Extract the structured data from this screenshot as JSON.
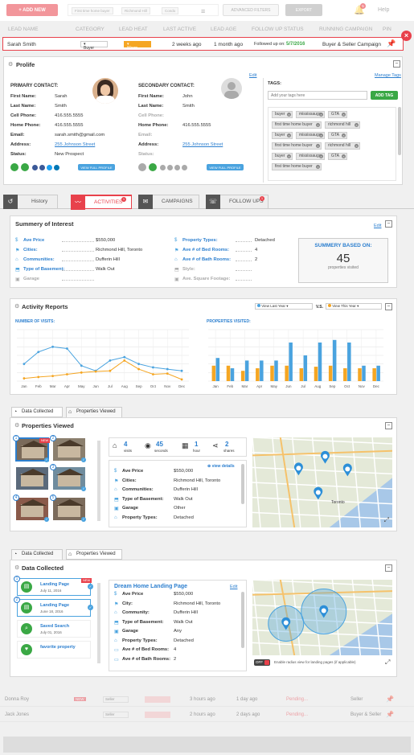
{
  "topbar": {
    "add_new": "+ ADD NEW",
    "filter_chips": [
      "First time home buyer",
      "Richmond Hill",
      "Condo"
    ],
    "advanced_filters": "ADVANCED FILTERS",
    "export": "EXPORT",
    "help": "Help",
    "notif_count": "5"
  },
  "columns": [
    "LEAD NAME",
    "CATEGORY",
    "LEAD HEAT",
    "LAST ACTIVE",
    "LEAD AGE",
    "FOLLOW UP STATUS",
    "RUNNING CAMPAIGN",
    "PIN"
  ],
  "lead": {
    "name": "Sarah Smith",
    "category": "Buyer",
    "heat": "Warm",
    "last_active": "2 weeks ago",
    "age": "1 month ago",
    "followup_label": "Followed up on:",
    "followup_date": "5/7/2016",
    "campaign": "Buyer & Seller Campaign"
  },
  "profile": {
    "title": "Prolife",
    "edit": "Edit",
    "manage_tags": "Manage Tags",
    "primary_header": "PRIMARY CONTACT:",
    "secondary_header": "SECONDARY CONTACT:",
    "primary": [
      {
        "label": "First Name:",
        "value": "Sarah"
      },
      {
        "label": "Last Name:",
        "value": "Smith"
      },
      {
        "label": "Cell Phone:",
        "value": "416.555.5555"
      },
      {
        "label": "Home Phone:",
        "value": "416.555.5555"
      },
      {
        "label": "Email:",
        "value": "sarah.smith@gmail.com"
      },
      {
        "label": "Address:",
        "value": "255 Johnson Street"
      },
      {
        "label": "Status:",
        "value": "New Prospect"
      }
    ],
    "secondary": [
      {
        "label": "First Name:",
        "value": "John"
      },
      {
        "label": "Last Name:",
        "value": "Smith"
      },
      {
        "label": "Cell Phone:",
        "value": ""
      },
      {
        "label": "Home Phone:",
        "value": "416.555.5555"
      },
      {
        "label": "Email:",
        "value": ""
      },
      {
        "label": "Address:",
        "value": "255 Johnson Street"
      },
      {
        "label": "Status:",
        "value": ""
      }
    ],
    "view_full_profile": "VIEW FULL PROFILE",
    "tags_label": "TAGS:",
    "tag_placeholder": "Add your tags here",
    "add_tag": "ADD TAG",
    "tags": [
      [
        "buyer",
        "mississauga",
        "GTA"
      ],
      [
        "first time home buyer",
        "richmond hill"
      ],
      [
        "buyer",
        "mississauga",
        "GTA"
      ],
      [
        "first time home buyer",
        "richmond hill"
      ],
      [
        "buyer",
        "mississauga",
        "GTA"
      ],
      [
        "first time home buyer"
      ]
    ]
  },
  "tabs": [
    {
      "label": "History",
      "icon": "history-icon"
    },
    {
      "label": "ACTIVITIES",
      "icon": "pulse-icon",
      "badge": "1"
    },
    {
      "label": "CAMPAIGNS",
      "icon": "mail-icon"
    },
    {
      "label": "FOLLOW UPS",
      "icon": "followup-icon",
      "badge": "1"
    }
  ],
  "summary": {
    "title": "Summery of Interest",
    "edit": "Edit",
    "left": [
      {
        "label": "Ave Price",
        "value": "$550,000"
      },
      {
        "label": "Cities:",
        "value": "Richmond Hill, Toronto"
      },
      {
        "label": "Communities:",
        "value": "Dufferin Hill"
      },
      {
        "label": "Type of Basement:",
        "value": "Walk Out"
      },
      {
        "label": "Garage",
        "value": ""
      }
    ],
    "right": [
      {
        "label": "Property Types:",
        "value": "Detached"
      },
      {
        "label": "Ave # of Bed Rooms:",
        "value": "4"
      },
      {
        "label": "Ave # of Bath Rooms:",
        "value": "2"
      },
      {
        "label": "Style:",
        "value": ""
      },
      {
        "label": "Ave. Square Footage:",
        "value": ""
      }
    ],
    "box_title": "SUMMERY BASED ON:",
    "box_count": "45",
    "box_caption": "properties visited"
  },
  "activity": {
    "title": "Activity Reports",
    "select_a": "View Last Year",
    "vs": "V.S.",
    "select_b": "View This Year",
    "visits_title": "NUMBER OF VISITS:",
    "props_title": "PROPERTIES VISITED:",
    "months": [
      "Jan",
      "Feb",
      "Mar",
      "Apr",
      "May",
      "Jun",
      "Jul",
      "Aug",
      "Sep",
      "Oct",
      "Nov",
      "Dec"
    ]
  },
  "chart_data": [
    {
      "type": "line",
      "title": "NUMBER OF VISITS:",
      "categories": [
        "Jan",
        "Feb",
        "Mar",
        "Apr",
        "May",
        "Jun",
        "Jul",
        "Aug",
        "Sep",
        "Oct",
        "Nov",
        "Dec"
      ],
      "series": [
        {
          "values": [
            50,
            85,
            100,
            95,
            45,
            30,
            60,
            70,
            50,
            40,
            35,
            30
          ],
          "color": "#4aa3df"
        },
        {
          "values": [
            8,
            12,
            15,
            20,
            25,
            28,
            30,
            60,
            35,
            20,
            22,
            5
          ],
          "color": "#f5a623"
        }
      ],
      "ylim": [
        0,
        150
      ]
    },
    {
      "type": "bar",
      "title": "PROPERTIES VISITED:",
      "categories": [
        "Jan",
        "Feb",
        "Mar",
        "Apr",
        "May",
        "Jun",
        "Jul",
        "Aug",
        "Sep",
        "Oct",
        "Nov",
        "Dec"
      ],
      "series": [
        {
          "values": [
            30,
            30,
            20,
            25,
            30,
            30,
            25,
            28,
            30,
            25,
            25,
            25
          ],
          "color": "#f5a623"
        },
        {
          "values": [
            45,
            25,
            40,
            40,
            40,
            75,
            50,
            75,
            80,
            75,
            30,
            30
          ],
          "color": "#4aa3df"
        }
      ],
      "ylim": [
        0,
        100
      ]
    }
  ],
  "viewed": {
    "tab_a": "Data Collected",
    "tab_b": "Properties Viewed",
    "title": "Properties Viewed",
    "stats": [
      {
        "value": "4",
        "unit": "visits"
      },
      {
        "value": "45",
        "unit": "seconds"
      },
      {
        "value": "1",
        "unit": "hour"
      },
      {
        "value": "2",
        "unit": "shares"
      }
    ],
    "view_details": "view details",
    "details": [
      {
        "label": "Ave Price",
        "value": "$550,000"
      },
      {
        "label": "Cities:",
        "value": "Richmond Hill, Toronto"
      },
      {
        "label": "Communities:",
        "value": "Dufferin Hill"
      },
      {
        "label": "Type of Basement:",
        "value": "Walk Out"
      },
      {
        "label": "Garage",
        "value": "Other"
      },
      {
        "label": "Property Types:",
        "value": "Detached"
      }
    ],
    "thumb_badges": [
      "1",
      "2",
      "3",
      "4",
      "5"
    ],
    "new_label": "NEW",
    "map_city": "Toronto"
  },
  "collected": {
    "tab_a": "Data Collected",
    "tab_b": "Properties Viewed",
    "title": "Data Collected",
    "items": [
      {
        "title": "Landing Page",
        "date": "July 11, 2016",
        "badge": "1"
      },
      {
        "title": "Landing Page",
        "date": "June 18, 2016",
        "badge": "2"
      },
      {
        "title": "Saved Search",
        "date": "July 01, 2016"
      },
      {
        "title": "favorite property",
        "date": ""
      }
    ],
    "new_label": "NEW",
    "page_title": "Dream Home Landing Page",
    "edit": "Edit",
    "details": [
      {
        "label": "Ave Price",
        "value": "$550,000"
      },
      {
        "label": "City:",
        "value": "Richmond Hill, Toronto"
      },
      {
        "label": "Community:",
        "value": "Dufferin Hill"
      },
      {
        "label": "Type of Basement:",
        "value": "Walk Out"
      },
      {
        "label": "Garage",
        "value": "Any"
      },
      {
        "label": "Property Types:",
        "value": "Detached"
      },
      {
        "label": "Ave # of Bed Rooms:",
        "value": "4"
      },
      {
        "label": "Ave # of Bath Rooms:",
        "value": "2"
      }
    ],
    "toggle": "OFF",
    "toggle_caption": "Enable radius view for landing pages (if applicable)"
  },
  "other_leads": [
    {
      "name": "Donna Roy",
      "badge": "NEW",
      "category": "Seller",
      "last_active": "3 hours ago",
      "age": "1 day ago",
      "status": "Pending...",
      "campaign": "Seller"
    },
    {
      "name": "Jack Jones",
      "badge": "",
      "category": "Seller",
      "last_active": "2 hours ago",
      "age": "2 days ago",
      "status": "Pending...",
      "campaign": "Buyer & Seller"
    }
  ]
}
